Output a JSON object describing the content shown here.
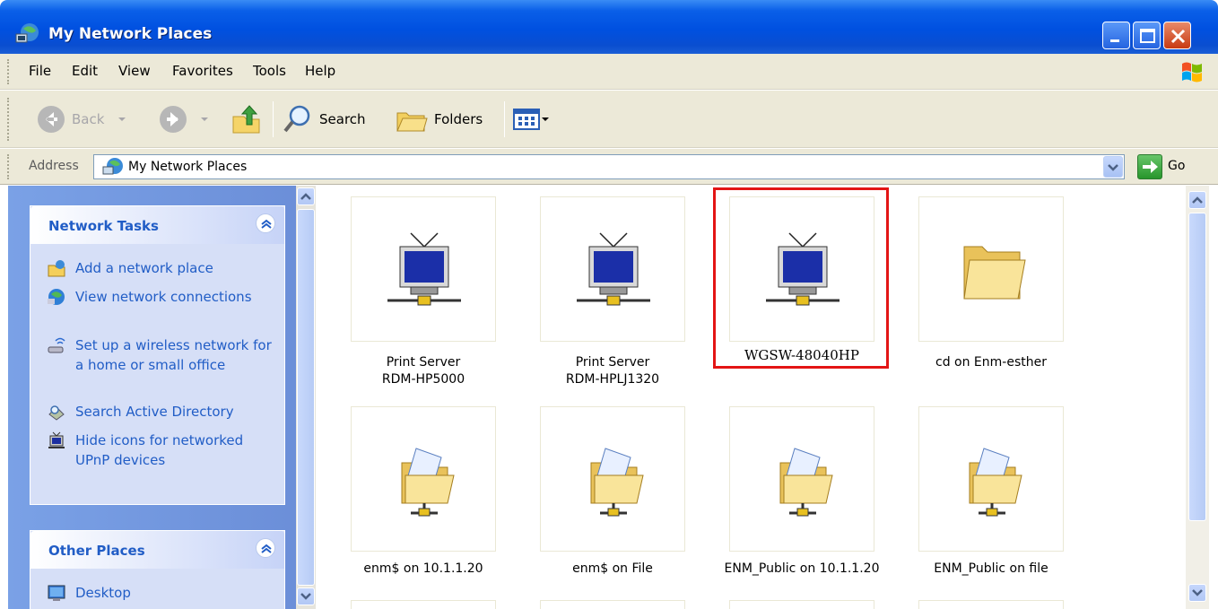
{
  "window": {
    "title": "My Network Places"
  },
  "menu": {
    "items": [
      "File",
      "Edit",
      "View",
      "Favorites",
      "Tools",
      "Help"
    ]
  },
  "toolbar": {
    "back_label": "Back",
    "search_label": "Search",
    "folders_label": "Folders"
  },
  "address": {
    "label": "Address",
    "value": "My Network Places",
    "go_label": "Go"
  },
  "network_tasks": {
    "title": "Network Tasks",
    "items": [
      {
        "label": "Add a network place",
        "icon": "add-network-place-icon"
      },
      {
        "label": "View network connections",
        "icon": "network-connections-icon"
      },
      {
        "label": "Set up a wireless network for a home or small office",
        "icon": "wireless-icon"
      },
      {
        "label": "Search Active Directory",
        "icon": "search-directory-icon"
      },
      {
        "label": "Hide icons for networked UPnP devices",
        "icon": "upnp-icon"
      }
    ]
  },
  "other_places": {
    "title": "Other Places",
    "items": [
      {
        "label": "Desktop",
        "icon": "desktop-icon"
      }
    ]
  },
  "items": [
    {
      "line1": "Print Server",
      "line2": "RDM-HP5000",
      "icon": "upnp-device-icon"
    },
    {
      "line1": "Print Server",
      "line2": "RDM-HPLJ1320",
      "icon": "upnp-device-icon"
    },
    {
      "line1": "WGSW-48040HP",
      "line2": "",
      "icon": "upnp-device-icon",
      "selected": true
    },
    {
      "line1": "cd on Enm-esther",
      "line2": "",
      "icon": "folder-icon"
    },
    {
      "line1": "enm$ on 10.1.1.20",
      "line2": "",
      "icon": "network-share-icon"
    },
    {
      "line1": "enm$ on File",
      "line2": "",
      "icon": "network-share-icon"
    },
    {
      "line1": "ENM_Public on 10.1.1.20",
      "line2": "",
      "icon": "network-share-icon"
    },
    {
      "line1": "ENM_Public on file",
      "line2": "",
      "icon": "network-share-icon"
    }
  ],
  "colors": {
    "highlight": "#e31515",
    "task_link": "#215dc6",
    "titlebar": "#0050e0"
  }
}
